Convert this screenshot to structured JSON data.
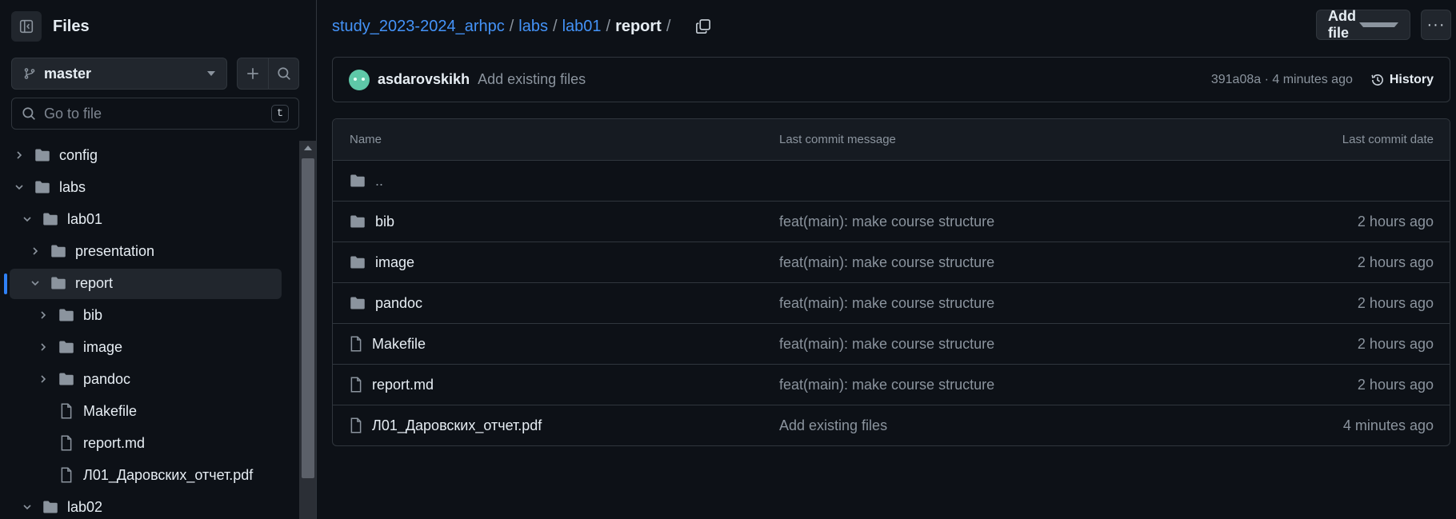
{
  "sidebar": {
    "title": "Files",
    "branch": "master",
    "search_placeholder": "Go to file",
    "search_shortcut": "t",
    "tree": [
      {
        "label": "config",
        "type": "folder",
        "expanded": false,
        "depth": 0
      },
      {
        "label": "labs",
        "type": "folder",
        "expanded": true,
        "depth": 0
      },
      {
        "label": "lab01",
        "type": "folder",
        "expanded": true,
        "depth": 1
      },
      {
        "label": "presentation",
        "type": "folder",
        "expanded": false,
        "depth": 2
      },
      {
        "label": "report",
        "type": "folder",
        "expanded": true,
        "depth": 2,
        "selected": true
      },
      {
        "label": "bib",
        "type": "folder",
        "expanded": false,
        "depth": 3
      },
      {
        "label": "image",
        "type": "folder",
        "expanded": false,
        "depth": 3
      },
      {
        "label": "pandoc",
        "type": "folder",
        "expanded": false,
        "depth": 3
      },
      {
        "label": "Makefile",
        "type": "file",
        "depth": 3
      },
      {
        "label": "report.md",
        "type": "file",
        "depth": 3
      },
      {
        "label": "Л01_Даровских_отчет.pdf",
        "type": "file",
        "depth": 3
      },
      {
        "label": "lab02",
        "type": "folder",
        "expanded": true,
        "depth": 1
      }
    ]
  },
  "breadcrumb": {
    "items": [
      {
        "label": "study_2023-2024_arhpc"
      },
      {
        "label": "labs"
      },
      {
        "label": "lab01"
      }
    ],
    "current": "report",
    "trailing_sep": "/"
  },
  "header": {
    "add_file_label": "Add file",
    "more_label": "···"
  },
  "commit": {
    "author": "asdarovskikh",
    "message": "Add existing files",
    "meta": "391a08a · 4 minutes ago",
    "history_label": "History"
  },
  "table": {
    "headers": {
      "name": "Name",
      "message": "Last commit message",
      "date": "Last commit date"
    },
    "parent_label": "..",
    "rows": [
      {
        "name": "bib",
        "type": "folder",
        "message": "feat(main): make course structure",
        "date": "2 hours ago"
      },
      {
        "name": "image",
        "type": "folder",
        "message": "feat(main): make course structure",
        "date": "2 hours ago"
      },
      {
        "name": "pandoc",
        "type": "folder",
        "message": "feat(main): make course structure",
        "date": "2 hours ago"
      },
      {
        "name": "Makefile",
        "type": "file",
        "message": "feat(main): make course structure",
        "date": "2 hours ago"
      },
      {
        "name": "report.md",
        "type": "file",
        "message": "feat(main): make course structure",
        "date": "2 hours ago"
      },
      {
        "name": "Л01_Даровских_отчет.pdf",
        "type": "file",
        "message": "Add existing files",
        "date": "4 minutes ago"
      }
    ]
  },
  "colors": {
    "background": "#0d1117",
    "link": "#4493f8",
    "accent_bar": "#2f81f7",
    "muted": "#8b949e"
  }
}
